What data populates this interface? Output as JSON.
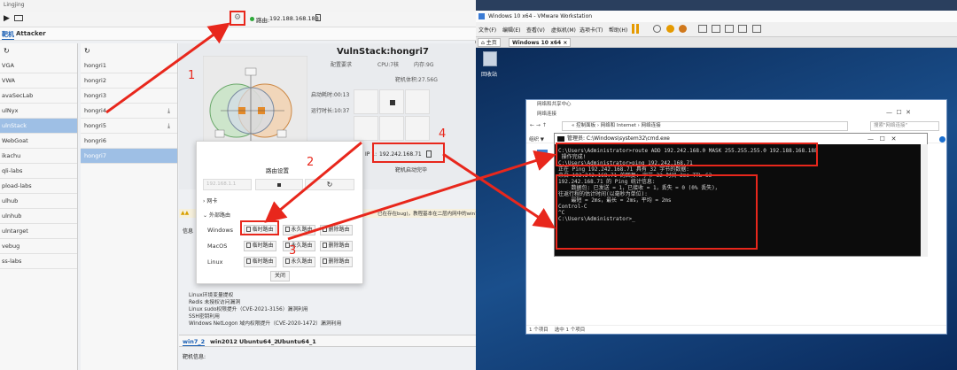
{
  "lingjing": {
    "title": "Lingjing",
    "route_label": "路由:",
    "route_ip": "192.188.168.188",
    "nav_tabs": [
      "靶机",
      "Attacker"
    ],
    "sidebar_refresh_icon": "refresh-icon",
    "sidebar_items": [
      "VGA",
      "VWA",
      "avaSecLab",
      "ulNyx",
      "ulnStack",
      "WebGoat",
      "ikachu",
      "qli-labs",
      "pload-labs",
      "ulhub",
      "ulnhub",
      "ulntarget",
      "vebug",
      "ss-labs"
    ],
    "sidebar_active_index": 4,
    "host_items": [
      {
        "name": "hongri1",
        "download": false
      },
      {
        "name": "hongri2",
        "download": false
      },
      {
        "name": "hongri3",
        "download": false
      },
      {
        "name": "hongri4",
        "download": true
      },
      {
        "name": "hongri5",
        "download": true
      },
      {
        "name": "hongri6",
        "download": false
      },
      {
        "name": "hongri7",
        "download": false
      }
    ],
    "host_active_index": 6,
    "main": {
      "vuln_title": "VulnStack:hongri7",
      "config_req": "配置要求",
      "cpu": "CPU:7核",
      "mem": "内存:9G",
      "disk": "靶机体积:27.56G",
      "boot_time": "启动耗时:00:13",
      "run_time": "运行时长:10:37",
      "ip_label": "IP 1:",
      "ip_value": "192.242.168.71",
      "auto_boot": "靶机启动完毕",
      "warning_text": "已在存在bug)，教程基本在二层内网中的win7",
      "info_prefix": "信息",
      "list_lines": [
        "Linux环境变量提权",
        "Redis 未授权访问漏洞",
        "Linux sudo权限提升（CVE-2021-3156）漏洞利用",
        "SSH密钥利用",
        "Windows NetLogon 域内权限提升（CVE-2020-1472）漏洞利用"
      ],
      "bottom_tabs": [
        "win7_2",
        "win2012",
        "Ubuntu64_2",
        "Ubuntu64_1"
      ],
      "bottom_info": "靶机信息:"
    },
    "modal": {
      "title": "路由设置",
      "ip_placeholder": "192.168.1.1",
      "section_nic": "网卡",
      "section_ext": "外部路由",
      "rows": [
        {
          "os": "Windows",
          "temp": "临时路由",
          "perm": "永久路由",
          "del": "删除路由"
        },
        {
          "os": "MacOS",
          "temp": "临时路由",
          "perm": "永久路由",
          "del": "删除路由"
        },
        {
          "os": "Linux",
          "temp": "临时路由",
          "perm": "永久路由",
          "del": "删除路由"
        }
      ],
      "close": "关闭"
    },
    "annotations": [
      "1",
      "2",
      "3",
      "4"
    ]
  },
  "vmware": {
    "title": "Windows 10 x64 - VMware Workstation",
    "menu": [
      "文件(F)",
      "编辑(E)",
      "查看(V)",
      "虚拟机(M)",
      "选项卡(T)",
      "帮助(H)"
    ],
    "tabs": [
      "主页",
      "Windows 10 x64"
    ],
    "recycle_bin": "回收站",
    "explorer": {
      "title": "网络和共享中心",
      "subtitle": "网络连接",
      "breadcrumb": "« 控制面板 › 网络和 Internet › 网络连接",
      "search_placeholder": "搜索\"网络连接\"",
      "organize": "组织 ▼",
      "status": "1 个项目    选中 1 个项目"
    },
    "cmd": {
      "title": "管理员: C:\\Windows\\system32\\cmd.exe",
      "lines": [
        "C:\\Users\\Administrator>route ADD 192.242.168.0 MASK 255.255.255.0 192.188.168.188",
        " 操作完成!",
        "",
        "C:\\Users\\Administrator>ping 192.242.168.71",
        "",
        "正在 Ping 192.242.168.71 具有 32 字节的数据:",
        "来自 192.242.168.71 的回复: 字节=32 时间=2ms TTL=63",
        "",
        "192.242.168.71 的 Ping 统计信息:",
        "    数据包: 已发送 = 1，已接收 = 1，丢失 = 0 (0% 丢失)，",
        "往返行程的估计时间(以毫秒为单位):",
        "    最短 = 2ms，最长 = 2ms，平均 = 2ms",
        "Control-C",
        "^C",
        "C:\\Users\\Administrator>_"
      ]
    }
  },
  "colors": {
    "annotation": "#e8271c",
    "active_row": "#9ebfe5",
    "online_dot": "#2eaa3a"
  }
}
